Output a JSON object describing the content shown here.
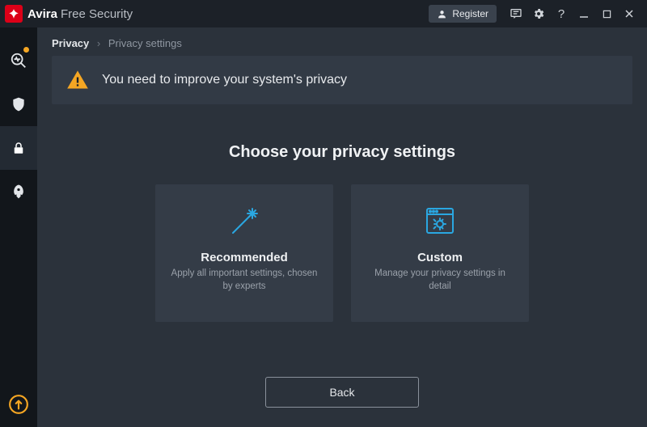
{
  "titlebar": {
    "brand": "Avira",
    "product": "Free Security",
    "register": "Register"
  },
  "breadcrumb": {
    "root": "Privacy",
    "leaf": "Privacy settings"
  },
  "alert": {
    "message": "You need to improve your system's privacy"
  },
  "heading": "Choose your privacy settings",
  "cards": {
    "recommended": {
      "title": "Recommended",
      "desc": "Apply all important settings, chosen by experts"
    },
    "custom": {
      "title": "Custom",
      "desc": "Manage your privacy settings in detail"
    }
  },
  "footer": {
    "back": "Back"
  }
}
